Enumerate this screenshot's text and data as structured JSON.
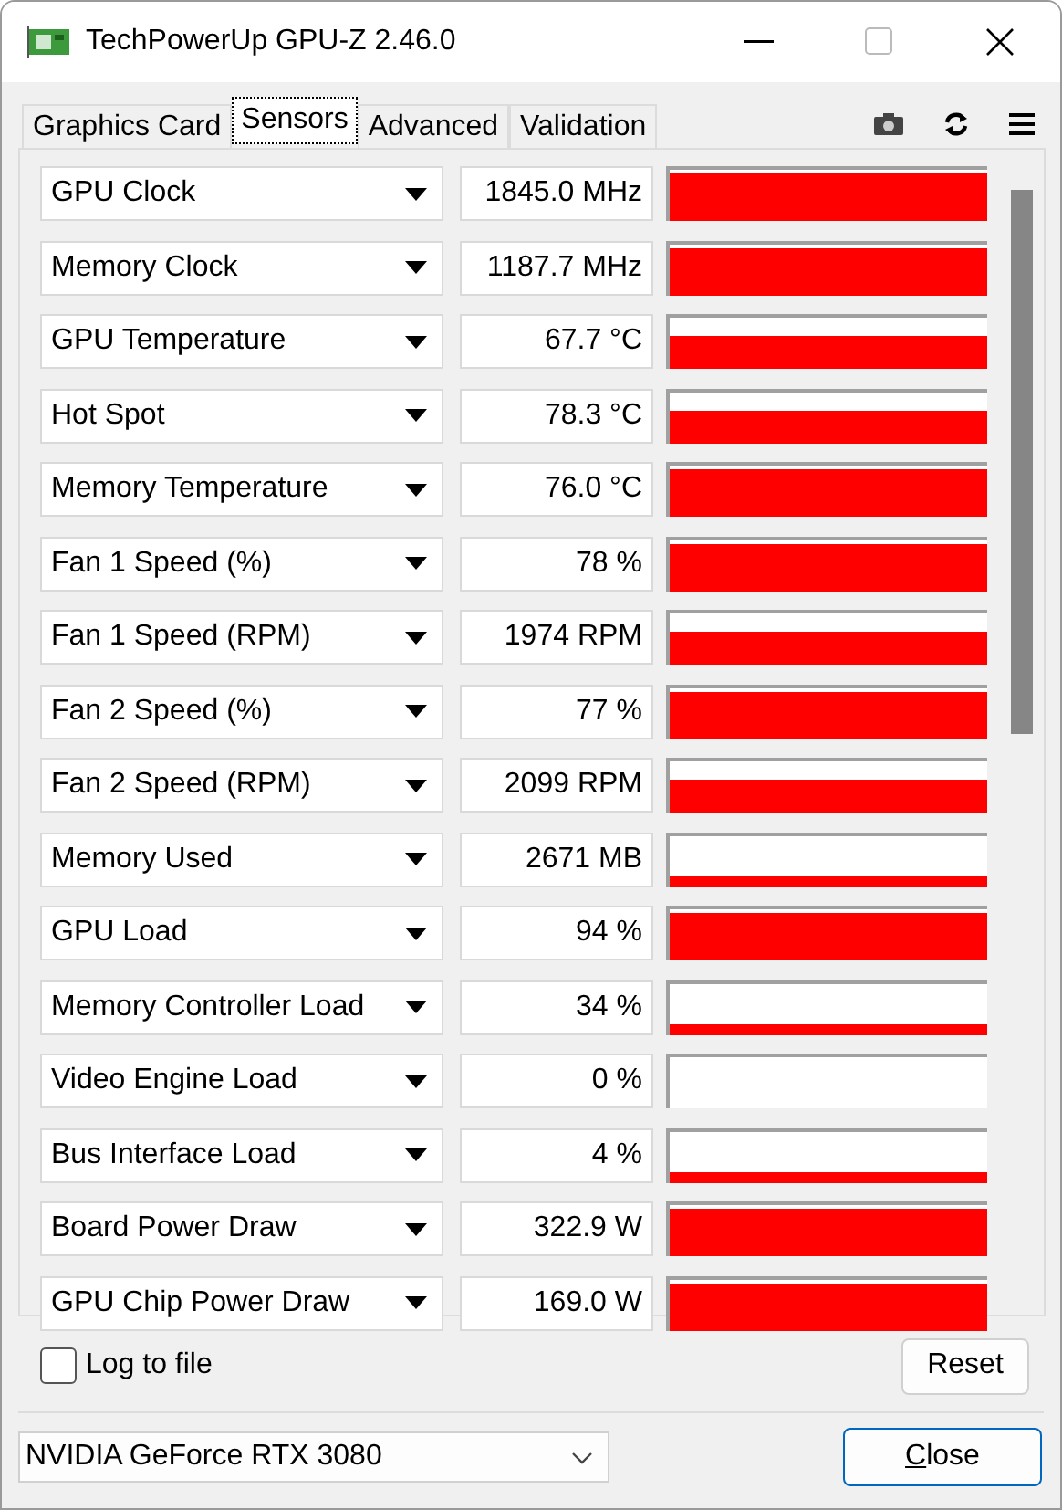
{
  "window": {
    "title": "TechPowerUp GPU-Z 2.46.0"
  },
  "tabs": [
    {
      "label": "Graphics Card",
      "selected": false
    },
    {
      "label": "Sensors",
      "selected": true
    },
    {
      "label": "Advanced",
      "selected": false
    },
    {
      "label": "Validation",
      "selected": false
    }
  ],
  "sensors": [
    {
      "name": "GPU Clock",
      "value": "1845.0 MHz",
      "kind": "high"
    },
    {
      "name": "Memory Clock",
      "value": "1187.7 MHz",
      "kind": "high"
    },
    {
      "name": "GPU Temperature",
      "value": "67.7 °C",
      "kind": "mid"
    },
    {
      "name": "Hot Spot",
      "value": "78.3 °C",
      "kind": "mid"
    },
    {
      "name": "Memory Temperature",
      "value": "76.0 °C",
      "kind": "high"
    },
    {
      "name": "Fan 1 Speed (%)",
      "value": "78 %",
      "kind": "high"
    },
    {
      "name": "Fan 1 Speed (RPM)",
      "value": "1974 RPM",
      "kind": "mid"
    },
    {
      "name": "Fan 2 Speed (%)",
      "value": "77 %",
      "kind": "high"
    },
    {
      "name": "Fan 2 Speed (RPM)",
      "value": "2099 RPM",
      "kind": "mid"
    },
    {
      "name": "Memory Used",
      "value": "2671 MB",
      "kind": "low"
    },
    {
      "name": "GPU Load",
      "value": "94 %",
      "kind": "high"
    },
    {
      "name": "Memory Controller Load",
      "value": "34 %",
      "kind": "low"
    },
    {
      "name": "Video Engine Load",
      "value": "0 %",
      "kind": "idle"
    },
    {
      "name": "Bus Interface Load",
      "value": "4 %",
      "kind": "low"
    },
    {
      "name": "Board Power Draw",
      "value": "322.9 W",
      "kind": "high"
    },
    {
      "name": "GPU Chip Power Draw",
      "value": "169.0 W",
      "kind": "high"
    }
  ],
  "log_to_file": {
    "label": "Log to file",
    "checked": false
  },
  "reset_button": "Reset",
  "gpu_select": {
    "value": "NVIDIA GeForce RTX 3080"
  },
  "close_button": "Close"
}
